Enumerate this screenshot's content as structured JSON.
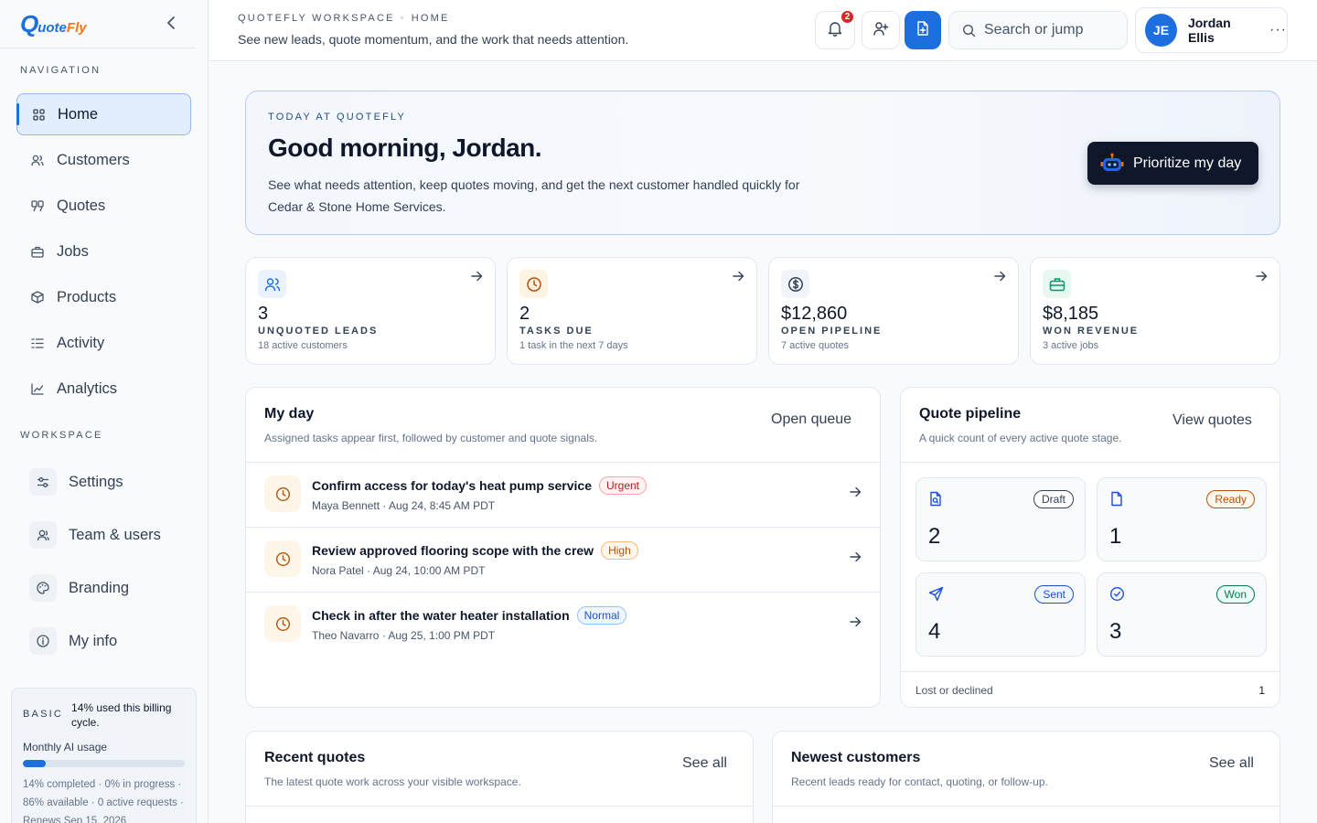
{
  "brand": {
    "q": "Q",
    "uote": "uote",
    "fly": "Fly"
  },
  "sidebar": {
    "nav_label": "NAVIGATION",
    "nav": [
      {
        "label": "Home",
        "icon": "grid-icon"
      },
      {
        "label": "Customers",
        "icon": "users-icon"
      },
      {
        "label": "Quotes",
        "icon": "quote-icon"
      },
      {
        "label": "Jobs",
        "icon": "briefcase-icon"
      },
      {
        "label": "Products",
        "icon": "package-icon"
      },
      {
        "label": "Activity",
        "icon": "list-icon"
      },
      {
        "label": "Analytics",
        "icon": "chart-icon"
      }
    ],
    "workspace_label": "WORKSPACE",
    "workspace": [
      {
        "label": "Settings",
        "icon": "sliders-icon"
      },
      {
        "label": "Team & users",
        "icon": "user-icon"
      },
      {
        "label": "Branding",
        "icon": "palette-icon"
      },
      {
        "label": "My info",
        "icon": "info-icon"
      }
    ],
    "billing": {
      "plan": "BASIC",
      "used": "14% used this billing cycle.",
      "usage_label": "Monthly AI usage",
      "usage_percent": 14,
      "meta1": "14% completed · 0% in progress ·",
      "meta2": "86% available · 0 active requests ·",
      "meta3": "Renews Sep 15, 2026"
    }
  },
  "header": {
    "crumb_a": "QUOTEFLY WORKSPACE",
    "crumb_b": "HOME",
    "subtitle": "See new leads, quote momentum, and the work that needs attention.",
    "notifications": "2",
    "search_placeholder": "Search or jump",
    "user_initials": "JE",
    "user_name": "Jordan Ellis",
    "more": "···"
  },
  "hero": {
    "eyebrow": "TODAY AT QUOTEFLY",
    "title": "Good morning, Jordan.",
    "body": "See what needs attention, keep quotes moving, and get the next customer handled quickly for Cedar & Stone Home Services.",
    "cta": "Prioritize my day"
  },
  "stats": [
    {
      "value": "3",
      "label": "UNQUOTED LEADS",
      "sub": "18 active customers",
      "color": "#1d6fe0",
      "bg": "#eaf2fd"
    },
    {
      "value": "2",
      "label": "TASKS DUE",
      "sub": "1 task in the next 7 days",
      "color": "#b45309",
      "bg": "#fdf3e3"
    },
    {
      "value": "$12,860",
      "label": "OPEN PIPELINE",
      "sub": "7 active quotes",
      "color": "#334155",
      "bg": "#f1f5f9"
    },
    {
      "value": "$8,185",
      "label": "WON REVENUE",
      "sub": "3 active jobs",
      "color": "#059669",
      "bg": "#e8f8f1"
    }
  ],
  "myday": {
    "title": "My day",
    "subtitle": "Assigned tasks appear first, followed by customer and quote signals.",
    "link": "Open queue",
    "tasks": [
      {
        "title": "Confirm access for today's heat pump service",
        "priority": "Urgent",
        "meta": "Maya Bennett · Aug 24, 8:45 AM PDT"
      },
      {
        "title": "Review approved flooring scope with the crew",
        "priority": "High",
        "meta": "Nora Patel · Aug 24, 10:00 AM PDT"
      },
      {
        "title": "Check in after the water heater installation",
        "priority": "Normal",
        "meta": "Theo Navarro · Aug 25, 1:00 PM PDT"
      }
    ]
  },
  "pipeline": {
    "title": "Quote pipeline",
    "subtitle": "A quick count of every active quote stage.",
    "link": "View quotes",
    "stages": [
      {
        "label": "Draft",
        "count": "2"
      },
      {
        "label": "Ready",
        "count": "1"
      },
      {
        "label": "Sent",
        "count": "4"
      },
      {
        "label": "Won",
        "count": "3"
      }
    ],
    "lost_label": "Lost or declined",
    "lost_count": "1"
  },
  "recent": {
    "title": "Recent quotes",
    "subtitle": "The latest quote work across your visible workspace.",
    "link": "See all"
  },
  "newest": {
    "title": "Newest customers",
    "subtitle": "Recent leads ready for contact, quoting, or follow-up.",
    "link": "See all"
  }
}
